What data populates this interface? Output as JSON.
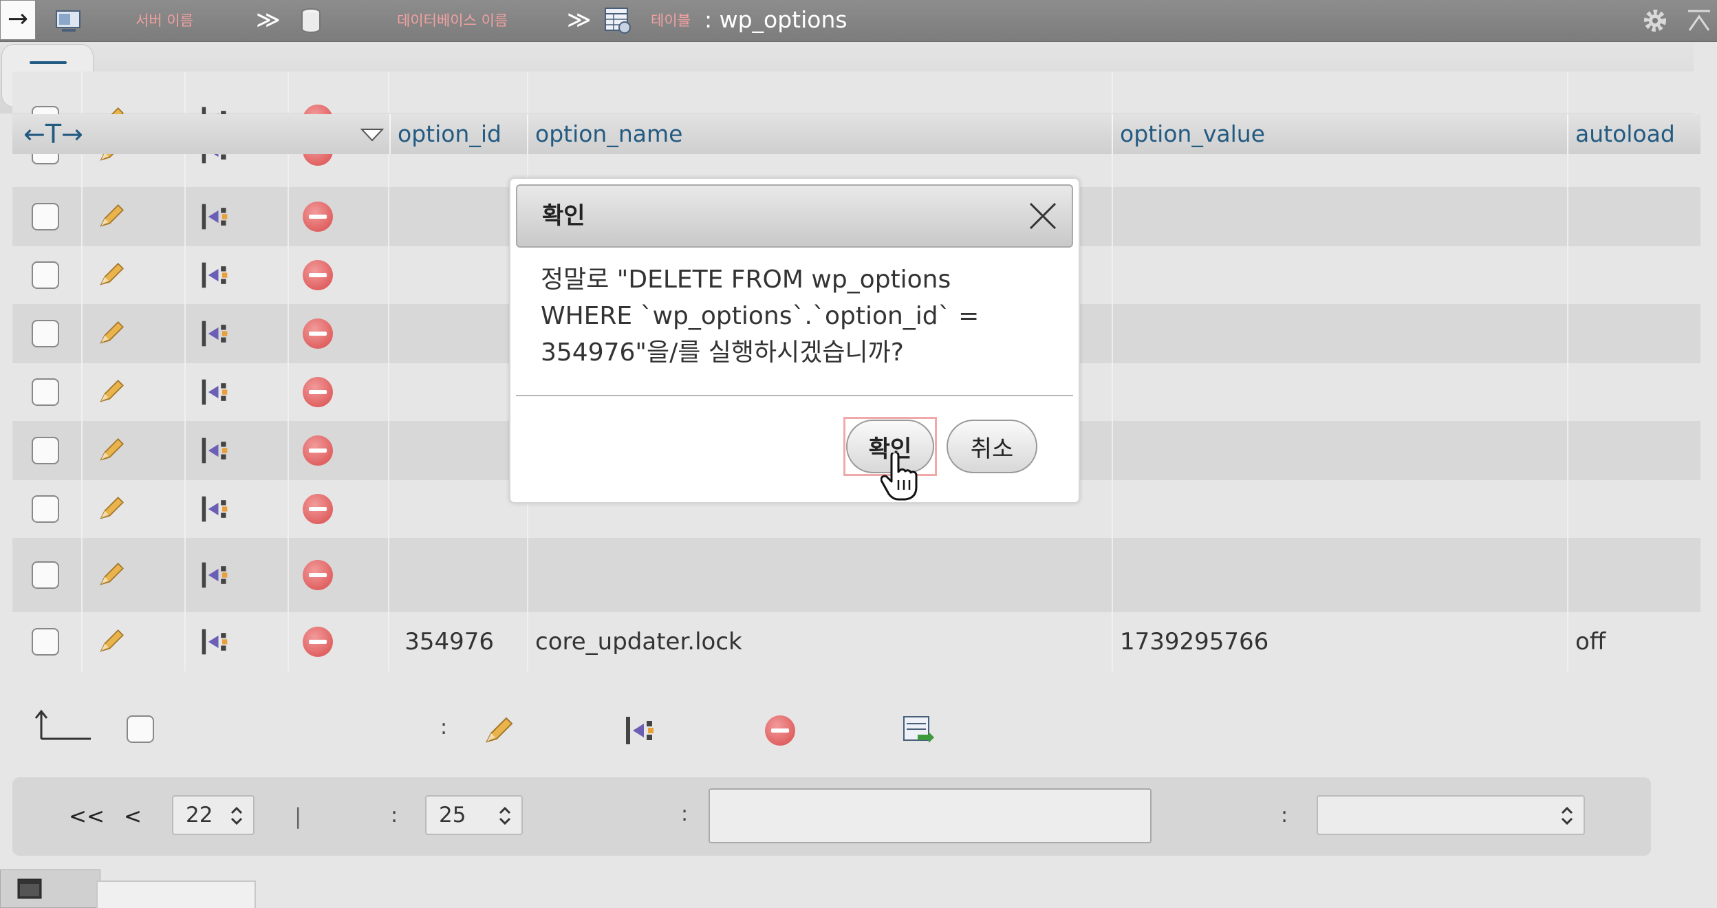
{
  "topbar": {
    "arrow": "→",
    "server_label": "서버 이름",
    "sep1": "≫",
    "database_label": "데이터베이스 이름",
    "sep2": "≫",
    "table_label": "테이블",
    "table_name": ": wp_options"
  },
  "table": {
    "columns": [
      "option_id",
      "option_name",
      "option_value",
      "autoload"
    ],
    "resize_glyph": "←T→",
    "last_row": {
      "option_id": "354976",
      "option_name": "core_updater.lock",
      "option_value": "1739295766",
      "autoload": "off"
    }
  },
  "bottom_actions": {
    "colon": ":"
  },
  "pager": {
    "first": "<<",
    "prev": "<",
    "page": "22",
    "separator": "|",
    "colon1": ":",
    "rows_per_page": "25",
    "colon2": ":",
    "filter_value": "",
    "colon3": ":",
    "sort_value": ""
  },
  "dialog": {
    "title": "확인",
    "message": "정말로 \"DELETE FROM wp_options WHERE `wp_options`.`option_id` = 354976\"을/를 실행하시겠습니까?",
    "confirm_label": "확인",
    "cancel_label": "취소"
  },
  "colors": {
    "header_text": "#235a81",
    "delete_icon": "#d94b4b",
    "focus_ring": "#f1a8a8"
  }
}
